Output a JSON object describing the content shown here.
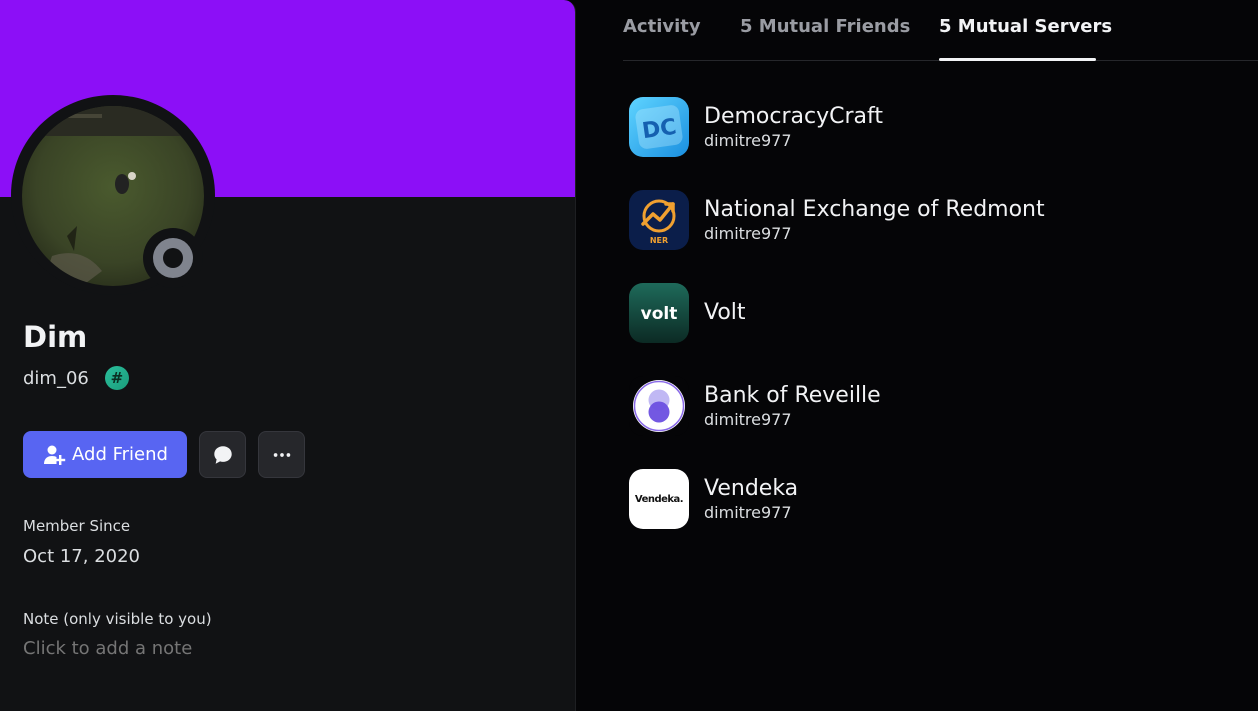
{
  "profile": {
    "display_name": "Dim",
    "username": "dim_06",
    "badge_symbol": "#",
    "banner_color": "#8c0ff7",
    "status": "offline"
  },
  "actions": {
    "add_friend_label": "Add Friend",
    "message_icon": "chat-bubble-icon",
    "more_icon": "more-dots-icon"
  },
  "member_since": {
    "label": "Member Since",
    "value": "Oct 17, 2020"
  },
  "note": {
    "label": "Note (only visible to you)",
    "placeholder": "Click to add a note"
  },
  "tabs": [
    {
      "label": "Activity",
      "active": false
    },
    {
      "label": "5 Mutual Friends",
      "active": false
    },
    {
      "label": "5 Mutual Servers",
      "active": true
    }
  ],
  "servers": [
    {
      "name": "DemocracyCraft",
      "nickname": "dimitre977"
    },
    {
      "name": "National Exchange of Redmont",
      "nickname": "dimitre977",
      "icon_text": "NER"
    },
    {
      "name": "Volt",
      "nickname": "",
      "icon_text": "volt"
    },
    {
      "name": "Bank of Reveille",
      "nickname": "dimitre977"
    },
    {
      "name": "Vendeka",
      "nickname": "dimitre977",
      "icon_text": "Vendeka."
    }
  ],
  "colors": {
    "accent": "#5865f2",
    "background": "#111214"
  }
}
